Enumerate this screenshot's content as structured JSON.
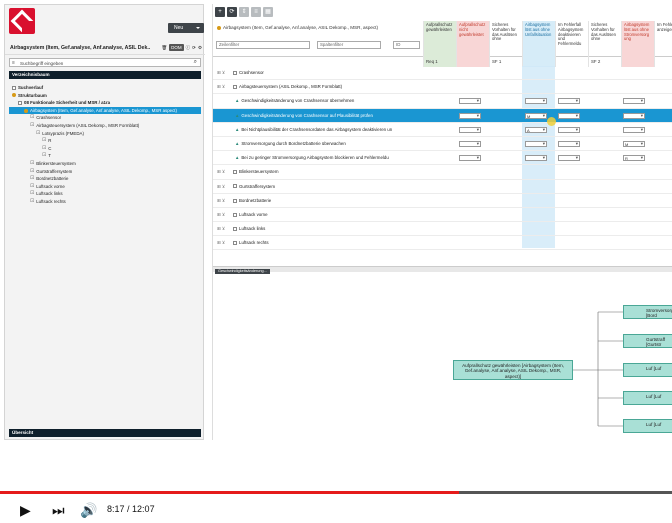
{
  "left": {
    "new_button": "Neu",
    "project_title": "Airbagsystem (Item, Gef.analyse, Anf.analyse, ASIL Dek...",
    "dom_tag": "DOM",
    "search_placeholder": "Suchbegriff eingeben",
    "section_directory": "Verzeichnisbaum",
    "section_overview": "Übersicht",
    "tree": [
      {
        "label": "Suchverlauf",
        "level": 0,
        "icon": "box",
        "bold": true
      },
      {
        "label": "Strukturbaum",
        "level": 0,
        "icon": "gold",
        "bold": true
      },
      {
        "label": "08 Funktionale Sicherheit und MSR / a1ra",
        "level": 1,
        "icon": "box",
        "bold": true
      },
      {
        "label": "Airbagsystem (Item, Gef.analyse, Anf.analyse, ASIL Dekomp., MSR aspect)",
        "level": 2,
        "icon": "gold",
        "selected": true
      },
      {
        "label": "Crashsensor",
        "level": 3,
        "icon": "leaf"
      },
      {
        "label": "Airbagsteuersystem (ASIL Dekomp., MSR Formblatt)",
        "level": 3,
        "icon": "leaf"
      },
      {
        "label": "Lotsyprazis (FMEDA)",
        "level": 4,
        "icon": "leaf"
      },
      {
        "label": "R",
        "level": 5,
        "icon": "leaf"
      },
      {
        "label": "C",
        "level": 5,
        "icon": "leaf"
      },
      {
        "label": "T",
        "level": 5,
        "icon": "leaf"
      },
      {
        "label": "Blinkersteuersystem",
        "level": 3,
        "icon": "leaf"
      },
      {
        "label": "Gurtstraffersystem",
        "level": 3,
        "icon": "leaf"
      },
      {
        "label": "Bordnetzbatterie",
        "level": 3,
        "icon": "leaf"
      },
      {
        "label": "Luftsack vorne",
        "level": 3,
        "icon": "leaf"
      },
      {
        "label": "Luftsack links",
        "level": 3,
        "icon": "leaf"
      },
      {
        "label": "Luftsack rechts",
        "level": 3,
        "icon": "leaf"
      }
    ]
  },
  "right": {
    "header_title": "Airbagsystem (Item, Gef.analyse, Anf.analyse, ASIL Dekomp., MSR, aspect)",
    "filter_left": "Zeilenfilter",
    "filter_right": "Spaltenfilter",
    "filter_id": "ID",
    "columns": [
      {
        "text": "Aufprallschutz gewährleisten",
        "req": "Req 1",
        "tone": "green"
      },
      {
        "text": "Aufprallschutz nicht gewährleistet",
        "req": "",
        "tone": "pink"
      },
      {
        "text": "Sicheres Vorhalten für das Auslösen ohne",
        "req": "SF 1",
        "tone": "white"
      },
      {
        "text": "Airbagsystem löst aus ohne Unfallsituation",
        "req": "",
        "tone": "blue"
      },
      {
        "text": "Im Fehlerfall Airbagsystem deaktivieren und Fehlermeldu",
        "req": "",
        "tone": "white"
      },
      {
        "text": "Sicheres Vorhalten für das Auslösen ohne",
        "req": "SF 2",
        "tone": "white"
      },
      {
        "text": "Airbagsystem löst aus ohne Stromversorg ung",
        "req": "",
        "tone": "pink"
      },
      {
        "text": "Im Fehlerfall anzeigen",
        "req": "",
        "tone": "white"
      }
    ],
    "rows": [
      {
        "label": "Crashsensor",
        "kind": "group",
        "selected": false
      },
      {
        "label": "Airbagsteuersystem (ASIL Dekomp., MSR Formblatt)",
        "kind": "group",
        "selected": false
      },
      {
        "label": "Geschwindigkeitsänderung von Crashsensor übernehmen",
        "kind": "func",
        "selected": false
      },
      {
        "label": "Geschwindigkeitsänderung von Crashsensor auf Plausibilität prüfen",
        "kind": "func",
        "selected": true,
        "cell": "M"
      },
      {
        "label": "Bei Nichtplausibilität der Crashsensordaten das Airbagsystem deaktivieren un",
        "kind": "func",
        "selected": false,
        "cell": "A"
      },
      {
        "label": "Stromversorgung durch Bordnetzbatterie überwachen",
        "kind": "func",
        "selected": false,
        "cell2": "M"
      },
      {
        "label": "Bei zu geringer Stromversorgung Airbagsystem blockieren und Fehlermeldu",
        "kind": "func",
        "selected": false,
        "cell2": "R"
      },
      {
        "label": "Blinkersteuersystem",
        "kind": "group",
        "selected": false
      },
      {
        "label": "Gurtstraffersystem",
        "kind": "group",
        "selected": false
      },
      {
        "label": "Bordnetzbatterie",
        "kind": "group",
        "selected": false
      },
      {
        "label": "Luftsack vorne",
        "kind": "group",
        "selected": false
      },
      {
        "label": "Luftsack links",
        "kind": "group",
        "selected": false
      },
      {
        "label": "Luftsack rechts",
        "kind": "group",
        "selected": false
      }
    ],
    "diagram_tab": "Geschwindigkeitsänderung...",
    "diagram": {
      "root": "Aufprallschutz gewährleisten [Airbagsystem (Item, Gef.analyse, Anf.analyse, ASIL Dekomp., MSR, aspect)]",
      "nodes": [
        "Stromversorg [Bord",
        "Gurtstraff [Gurtstr",
        "Luf [Luf",
        "Luf [Luf",
        "Luf [Luf"
      ]
    }
  },
  "video": {
    "current_time": "8:17",
    "total_time": "12:07",
    "progress": 0.683
  }
}
